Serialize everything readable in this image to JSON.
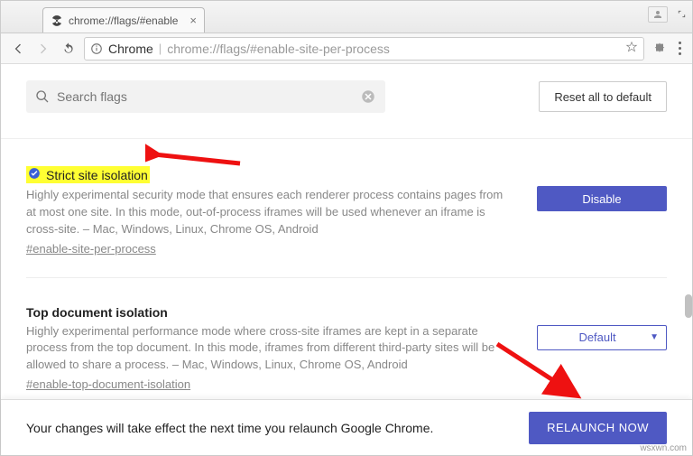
{
  "window": {
    "tab_title": "chrome://flags/#enable",
    "omnibox_scheme": "Chrome",
    "omnibox_path": "chrome://flags/#enable-site-per-process"
  },
  "search": {
    "placeholder": "Search flags"
  },
  "buttons": {
    "reset": "Reset all to default",
    "disable": "Disable",
    "default": "Default",
    "relaunch": "RELAUNCH NOW"
  },
  "flags": [
    {
      "title": "Strict site isolation",
      "desc": "Highly experimental security mode that ensures each renderer process contains pages from at most one site. In this mode, out-of-process iframes will be used whenever an iframe is cross-site.",
      "platforms": " – Mac, Windows, Linux, Chrome OS, Android",
      "link": "#enable-site-per-process"
    },
    {
      "title": "Top document isolation",
      "desc": "Highly experimental performance mode where cross-site iframes are kept in a separate process from the top document. In this mode, iframes from different third-party sites will be allowed to share a process.",
      "platforms": " – Mac, Windows, Linux, Chrome OS, Android",
      "link": "#enable-top-document-isolation"
    }
  ],
  "relaunch_msg": "Your changes will take effect the next time you relaunch Google Chrome.",
  "watermark": "wsxwn.com"
}
